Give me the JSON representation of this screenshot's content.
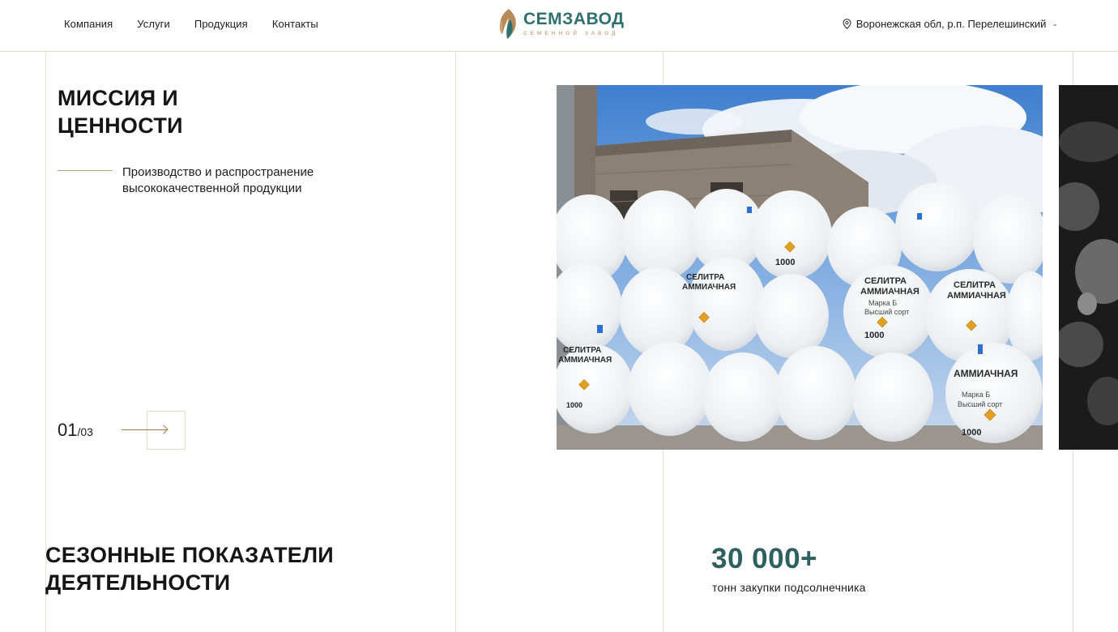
{
  "nav": {
    "items": [
      {
        "label": "Компания"
      },
      {
        "label": "Услуги"
      },
      {
        "label": "Продукция"
      },
      {
        "label": "Контакты"
      }
    ]
  },
  "logo": {
    "name": "СЕМЗАВОД",
    "subtitle": "СЕМЕННОЙ ЗАВОД"
  },
  "location": {
    "icon": "map-pin-icon",
    "text": "Воронежская обл, р.п. Перелешинский"
  },
  "mission": {
    "title_line1": "МИССИЯ И",
    "title_line2": "ЦЕННОСТИ",
    "text": "Производство и распространение высококачественной продукции",
    "counter_current": "01",
    "counter_total": "/03"
  },
  "photo": {
    "bag_title_line1": "СЕЛИТРА",
    "bag_title_line2": "АММИАЧНАЯ",
    "bag_grade_line1": "Марка Б",
    "bag_grade_line2": "Высший сорт",
    "bag_weight": "1000"
  },
  "season": {
    "title_line1": "СЕЗОННЫЕ ПОКАЗАТЕЛИ",
    "title_line2": "ДЕЯТЕЛЬНОСТИ",
    "stat_value": "30 000+",
    "stat_label": "тонн закупки подсолнечника"
  },
  "colors": {
    "brand_teal": "#2f6f6f",
    "brand_gold": "#b58b5a",
    "divider": "#e8e0d2"
  }
}
